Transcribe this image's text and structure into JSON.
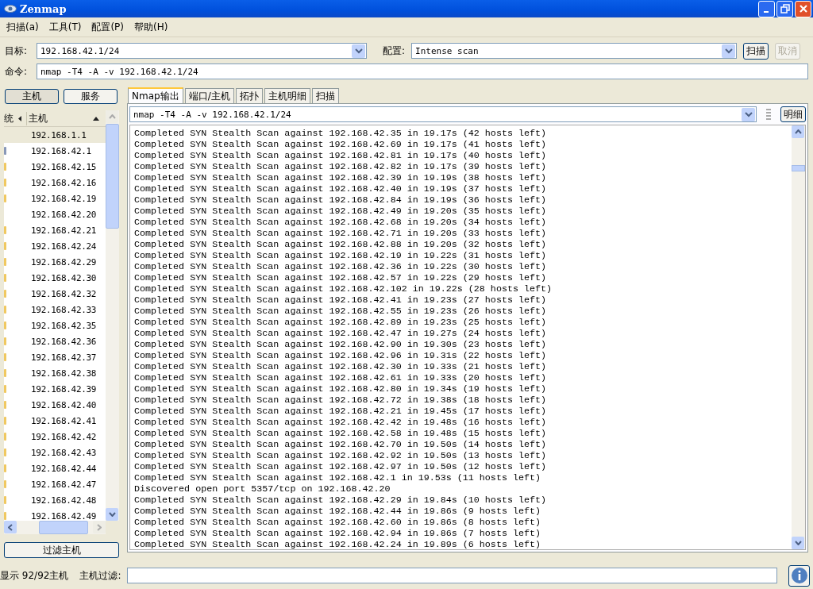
{
  "window": {
    "title": "Zenmap"
  },
  "menu": [
    "扫描(a)",
    "工具(T)",
    "配置(P)",
    "帮助(H)"
  ],
  "target": {
    "label": "目标:",
    "value": "192.168.42.1/24"
  },
  "profile": {
    "label": "配置:",
    "value": "Intense scan"
  },
  "scan_button": {
    "label": "扫描",
    "disabled": false
  },
  "cancel_button": {
    "label": "取消",
    "disabled": true
  },
  "command": {
    "label": "命令:",
    "value": "nmap -T4 -A -v 192.168.42.1/24"
  },
  "view_buttons": [
    {
      "label": "主机",
      "selected": true
    },
    {
      "label": "服务",
      "selected": false
    }
  ],
  "host_columns": [
    "统",
    "主机"
  ],
  "hosts": [
    {
      "ip": "192.168.1.1",
      "selected": true
    },
    {
      "ip": "192.168.42.1",
      "selected": false,
      "color": "#8898b8"
    },
    {
      "ip": "192.168.42.15",
      "selected": false,
      "color": "#f0c860"
    },
    {
      "ip": "192.168.42.16",
      "selected": false,
      "color": "#f0c860"
    },
    {
      "ip": "192.168.42.19",
      "selected": false,
      "color": "#f0c860"
    },
    {
      "ip": "192.168.42.20",
      "selected": false
    },
    {
      "ip": "192.168.42.21",
      "selected": false,
      "color": "#f0c860"
    },
    {
      "ip": "192.168.42.24",
      "selected": false,
      "color": "#f0c860"
    },
    {
      "ip": "192.168.42.29",
      "selected": false,
      "color": "#f0c860"
    },
    {
      "ip": "192.168.42.30",
      "selected": false,
      "color": "#f0c860"
    },
    {
      "ip": "192.168.42.32",
      "selected": false,
      "color": "#f0c860"
    },
    {
      "ip": "192.168.42.33",
      "selected": false,
      "color": "#f0c860"
    },
    {
      "ip": "192.168.42.35",
      "selected": false,
      "color": "#f0c860"
    },
    {
      "ip": "192.168.42.36",
      "selected": false,
      "color": "#f0c860"
    },
    {
      "ip": "192.168.42.37",
      "selected": false,
      "color": "#f0c860"
    },
    {
      "ip": "192.168.42.38",
      "selected": false,
      "color": "#f0c860"
    },
    {
      "ip": "192.168.42.39",
      "selected": false,
      "color": "#f0c860"
    },
    {
      "ip": "192.168.42.40",
      "selected": false,
      "color": "#f0c860"
    },
    {
      "ip": "192.168.42.41",
      "selected": false,
      "color": "#f0c860"
    },
    {
      "ip": "192.168.42.42",
      "selected": false,
      "color": "#f0c860"
    },
    {
      "ip": "192.168.42.43",
      "selected": false,
      "color": "#f0c860"
    },
    {
      "ip": "192.168.42.44",
      "selected": false,
      "color": "#f0c860"
    },
    {
      "ip": "192.168.42.47",
      "selected": false,
      "color": "#f0c860"
    },
    {
      "ip": "192.168.42.48",
      "selected": false,
      "color": "#f0c860"
    },
    {
      "ip": "192.168.42.49",
      "selected": false,
      "color": "#f0c860"
    }
  ],
  "filter_button": "过滤主机",
  "tabs": [
    {
      "label": "Nmap输出",
      "selected": true
    },
    {
      "label": "端口/主机",
      "selected": false
    },
    {
      "label": "拓扑",
      "selected": false
    },
    {
      "label": "主机明细",
      "selected": false
    },
    {
      "label": "扫描",
      "selected": false
    }
  ],
  "output_selector": {
    "value": "nmap -T4 -A -v 192.168.42.1/24"
  },
  "details_button": "明细",
  "output_lines": [
    "Completed SYN Stealth Scan against 192.168.42.35 in 19.17s (42 hosts left)",
    "Completed SYN Stealth Scan against 192.168.42.69 in 19.17s (41 hosts left)",
    "Completed SYN Stealth Scan against 192.168.42.81 in 19.17s (40 hosts left)",
    "Completed SYN Stealth Scan against 192.168.42.82 in 19.17s (39 hosts left)",
    "Completed SYN Stealth Scan against 192.168.42.39 in 19.19s (38 hosts left)",
    "Completed SYN Stealth Scan against 192.168.42.40 in 19.19s (37 hosts left)",
    "Completed SYN Stealth Scan against 192.168.42.84 in 19.19s (36 hosts left)",
    "Completed SYN Stealth Scan against 192.168.42.49 in 19.20s (35 hosts left)",
    "Completed SYN Stealth Scan against 192.168.42.68 in 19.20s (34 hosts left)",
    "Completed SYN Stealth Scan against 192.168.42.71 in 19.20s (33 hosts left)",
    "Completed SYN Stealth Scan against 192.168.42.88 in 19.20s (32 hosts left)",
    "Completed SYN Stealth Scan against 192.168.42.19 in 19.22s (31 hosts left)",
    "Completed SYN Stealth Scan against 192.168.42.36 in 19.22s (30 hosts left)",
    "Completed SYN Stealth Scan against 192.168.42.57 in 19.22s (29 hosts left)",
    "Completed SYN Stealth Scan against 192.168.42.102 in 19.22s (28 hosts left)",
    "Completed SYN Stealth Scan against 192.168.42.41 in 19.23s (27 hosts left)",
    "Completed SYN Stealth Scan against 192.168.42.55 in 19.23s (26 hosts left)",
    "Completed SYN Stealth Scan against 192.168.42.89 in 19.23s (25 hosts left)",
    "Completed SYN Stealth Scan against 192.168.42.47 in 19.27s (24 hosts left)",
    "Completed SYN Stealth Scan against 192.168.42.90 in 19.30s (23 hosts left)",
    "Completed SYN Stealth Scan against 192.168.42.96 in 19.31s (22 hosts left)",
    "Completed SYN Stealth Scan against 192.168.42.30 in 19.33s (21 hosts left)",
    "Completed SYN Stealth Scan against 192.168.42.61 in 19.33s (20 hosts left)",
    "Completed SYN Stealth Scan against 192.168.42.80 in 19.34s (19 hosts left)",
    "Completed SYN Stealth Scan against 192.168.42.72 in 19.38s (18 hosts left)",
    "Completed SYN Stealth Scan against 192.168.42.21 in 19.45s (17 hosts left)",
    "Completed SYN Stealth Scan against 192.168.42.42 in 19.48s (16 hosts left)",
    "Completed SYN Stealth Scan against 192.168.42.58 in 19.48s (15 hosts left)",
    "Completed SYN Stealth Scan against 192.168.42.70 in 19.50s (14 hosts left)",
    "Completed SYN Stealth Scan against 192.168.42.92 in 19.50s (13 hosts left)",
    "Completed SYN Stealth Scan against 192.168.42.97 in 19.50s (12 hosts left)",
    "Completed SYN Stealth Scan against 192.168.42.1 in 19.53s (11 hosts left)",
    "Discovered open port 5357/tcp on 192.168.42.20",
    "Completed SYN Stealth Scan against 192.168.42.29 in 19.84s (10 hosts left)",
    "Completed SYN Stealth Scan against 192.168.42.44 in 19.86s (9 hosts left)",
    "Completed SYN Stealth Scan against 192.168.42.60 in 19.86s (8 hosts left)",
    "Completed SYN Stealth Scan against 192.168.42.94 in 19.86s (7 hosts left)",
    "Completed SYN Stealth Scan against 192.168.42.24 in 19.89s (6 hosts left)"
  ],
  "status": {
    "count": "显示 92/92主机",
    "filter_label": "主机过滤:"
  }
}
